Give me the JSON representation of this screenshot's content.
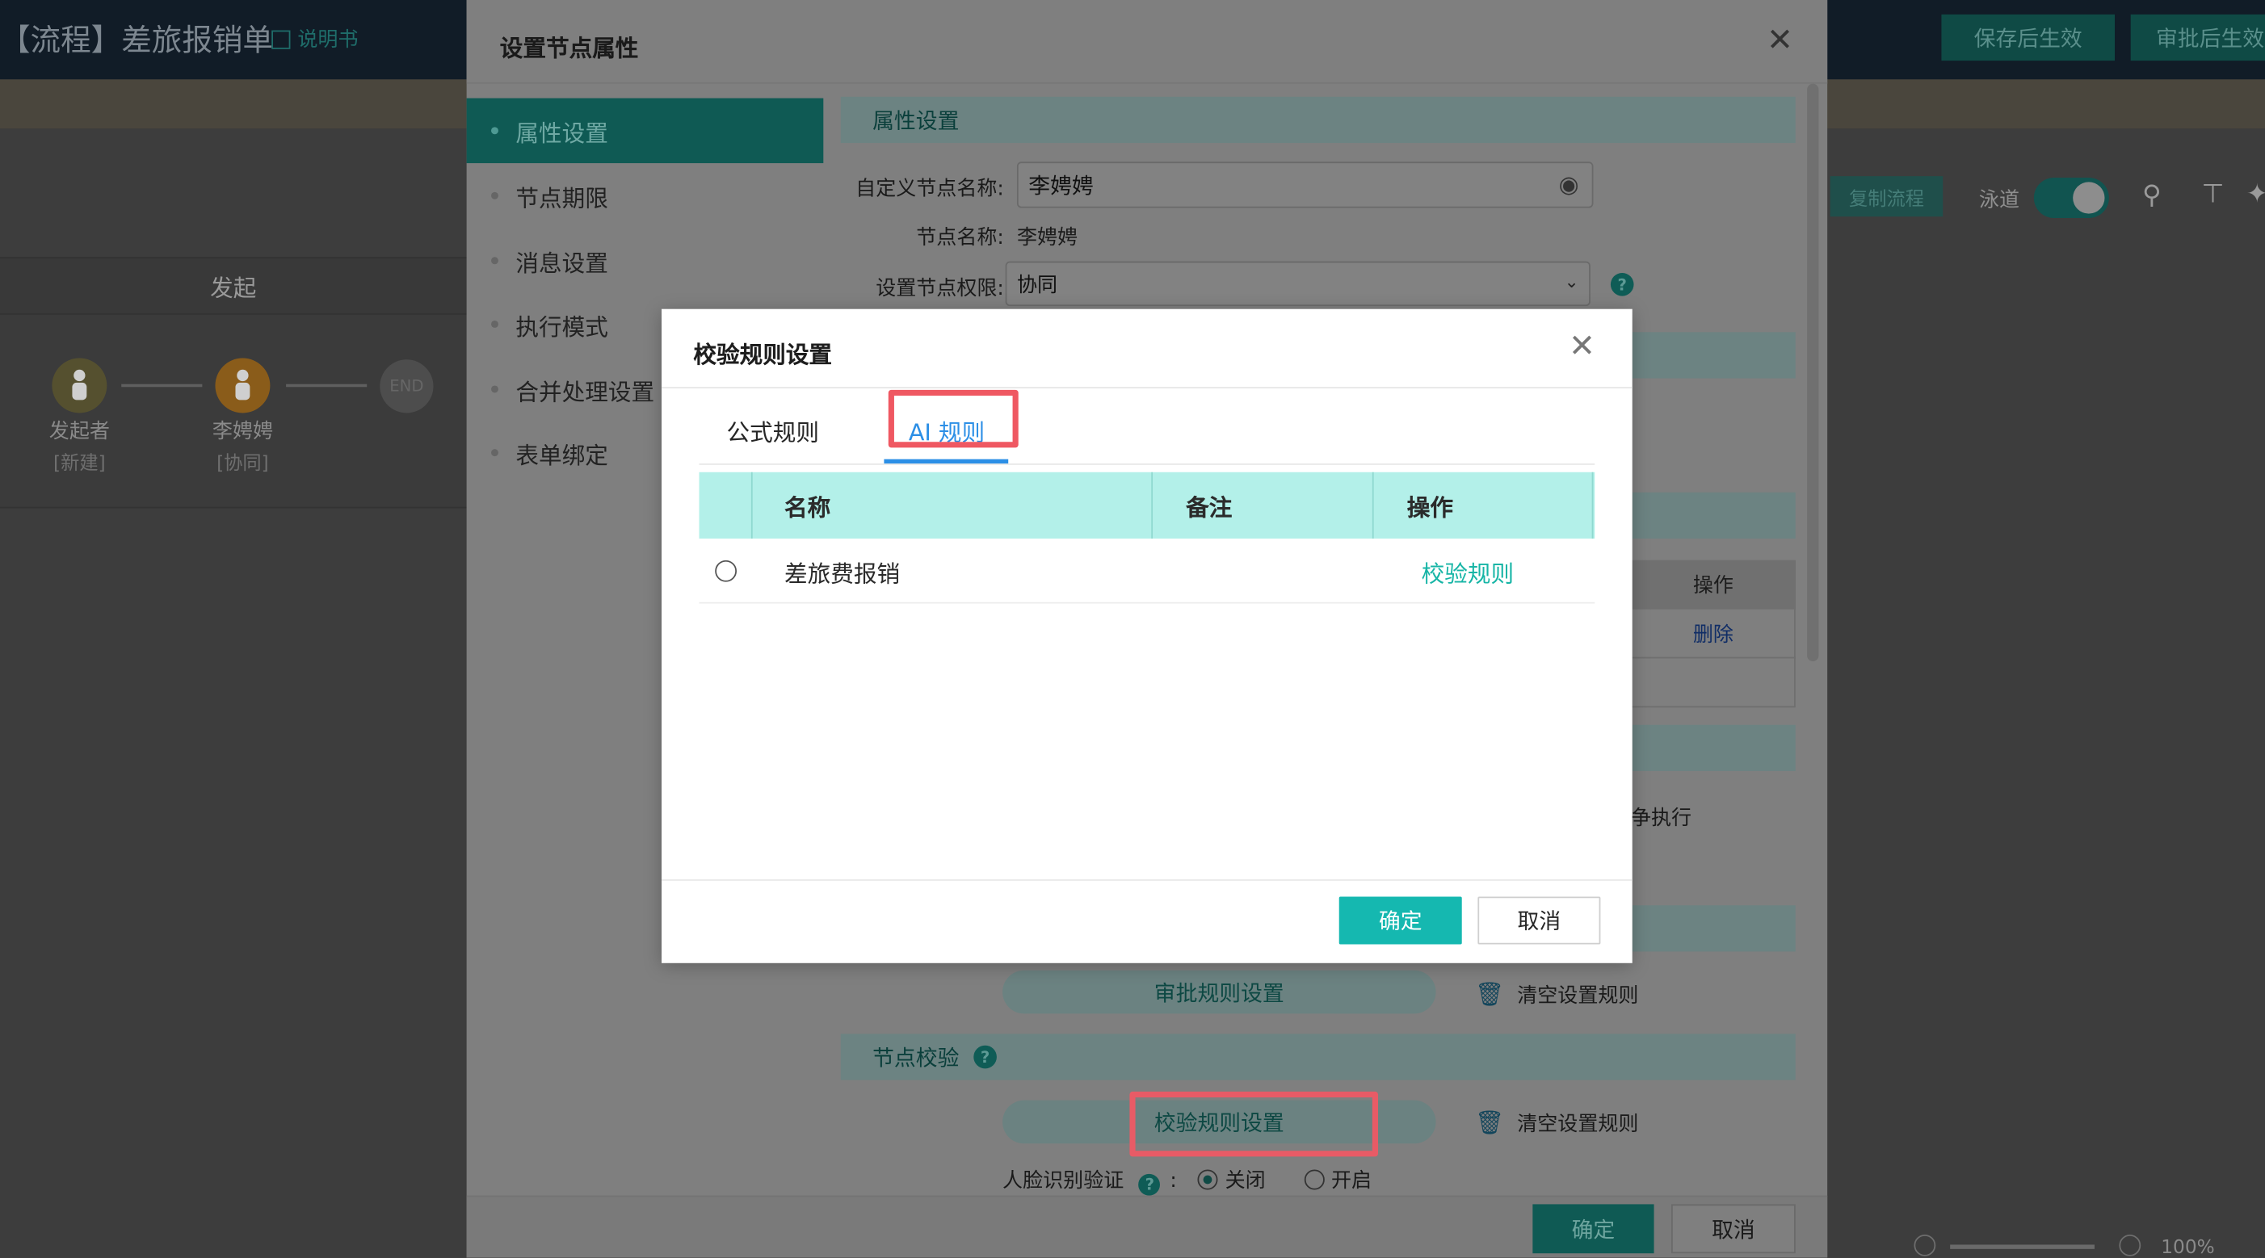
{
  "app": {
    "title": "【流程】差旅报销单",
    "manual": "说明书",
    "save_btn": "保存后生效",
    "approve_btn": "审批后生效"
  },
  "canvas": {
    "lane_title": "发起",
    "nodes": [
      {
        "name": "发起者",
        "sub": "[新建]",
        "color": "#55502f"
      },
      {
        "name": "李娉娉",
        "sub": "[协同]",
        "color": "#8a5c1a"
      }
    ],
    "end_label": "END",
    "copy_flow": "复制流程",
    "lane_toggle": "泳道",
    "zoom": "100%"
  },
  "node_dialog": {
    "title": "设置节点属性",
    "sidebar": [
      {
        "label": "属性设置",
        "active": true
      },
      {
        "label": "节点期限",
        "active": false
      },
      {
        "label": "消息设置",
        "active": false
      },
      {
        "label": "执行模式",
        "active": false
      },
      {
        "label": "合并处理设置",
        "active": false
      },
      {
        "label": "表单绑定",
        "active": false
      }
    ],
    "section_props": "属性设置",
    "custom_name_label": "自定义节点名称:",
    "custom_name_value": "李娉娉",
    "node_name_label": "节点名称:",
    "node_name_value": "李娉娉",
    "permission_label": "设置节点权限:",
    "permission_value": "协同",
    "table_op_header": "操作",
    "table_delete": "删除",
    "exec_fragment": "争执行",
    "approve_rule_btn": "审批规则设置",
    "clear_rule_1": "清空设置规则",
    "section_verify": "节点校验",
    "verify_rule_btn": "校验规则设置",
    "clear_rule_2": "清空设置规则",
    "face_label": "人脸识别验证",
    "colon": ":",
    "face_off": "关闭",
    "face_on": "开启",
    "ok": "确定",
    "cancel": "取消"
  },
  "rule_dialog": {
    "title": "校验规则设置",
    "tabs": [
      {
        "label": "公式规则",
        "active": false
      },
      {
        "label": "AI 规则",
        "active": true
      }
    ],
    "columns": [
      "名称",
      "备注",
      "操作"
    ],
    "rows": [
      {
        "name": "差旅费报销",
        "remark": "",
        "op": "校验规则"
      }
    ],
    "ok": "确定",
    "cancel": "取消",
    "accent": "#15b8b0",
    "tab_active_color": "#2c8fe6",
    "highlight_color": "#ef5862"
  }
}
